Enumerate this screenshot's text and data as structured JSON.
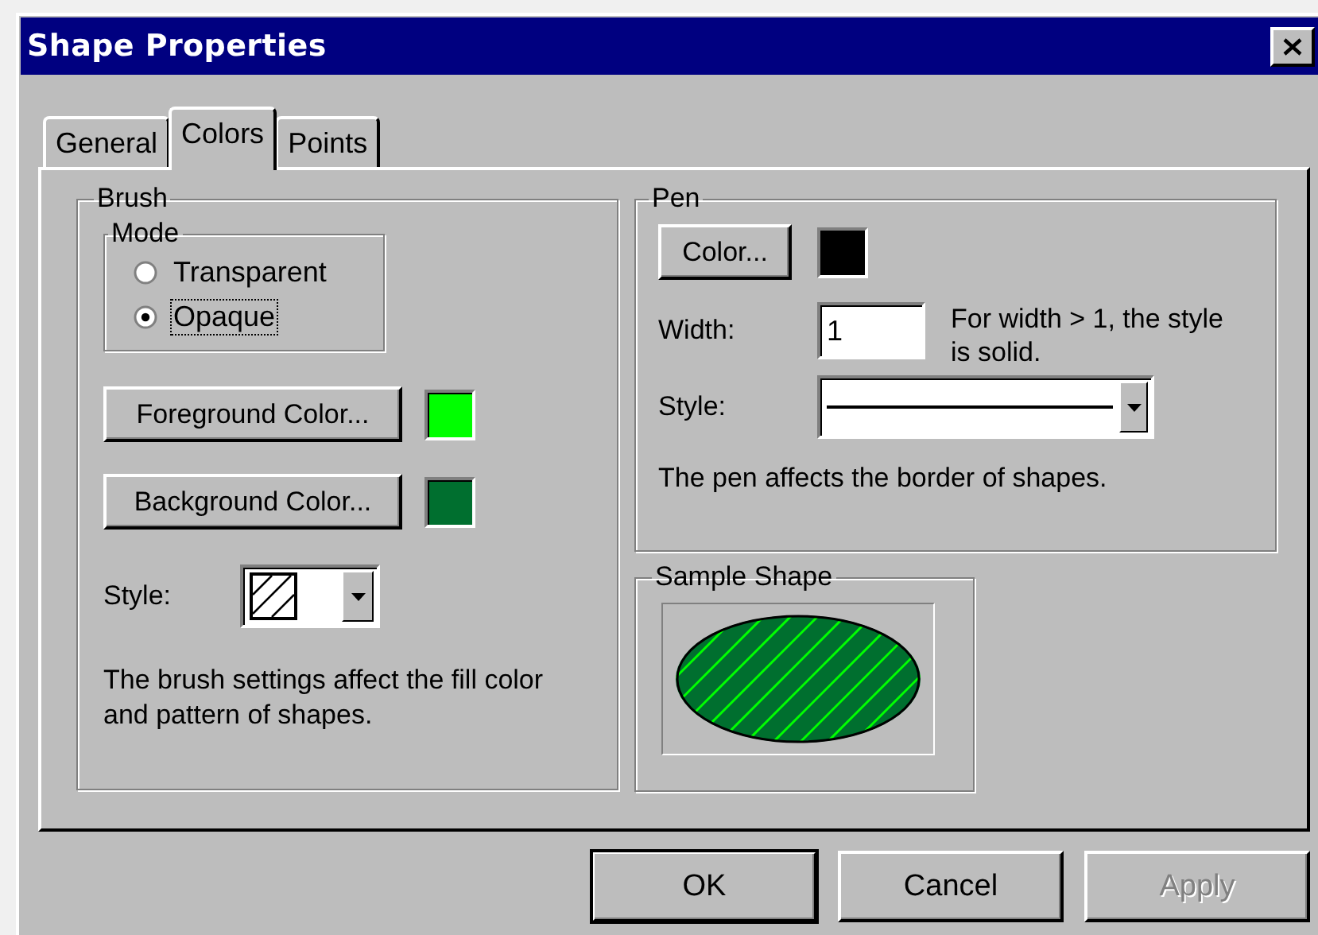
{
  "window": {
    "title": "Shape Properties"
  },
  "tabs": [
    {
      "label": "General",
      "selected": false
    },
    {
      "label": "Colors",
      "selected": true
    },
    {
      "label": "Points",
      "selected": false
    }
  ],
  "brush": {
    "title": "Brush",
    "mode": {
      "title": "Mode",
      "options": [
        {
          "label": "Transparent",
          "selected": false,
          "focused": false
        },
        {
          "label": "Opaque",
          "selected": true,
          "focused": true
        }
      ]
    },
    "color_buttons": [
      {
        "label": "Foreground Color...",
        "color": "#00ff00"
      },
      {
        "label": "Background Color...",
        "color": "#006f2f"
      }
    ],
    "style": {
      "label": "Style:"
    },
    "note": "The brush settings affect the fill color and pattern of shapes."
  },
  "pen": {
    "title": "Pen",
    "color_button": {
      "label": "Color...",
      "color": "#000000"
    },
    "width": {
      "label": "Width:",
      "value": "1"
    },
    "width_hint": "For width > 1, the style is solid.",
    "style": {
      "label": "Style:"
    },
    "note": "The pen affects the border of shapes."
  },
  "sample": {
    "title": "Sample Shape"
  },
  "buttons": [
    {
      "label": "OK",
      "default": true,
      "disabled": false
    },
    {
      "label": "Cancel",
      "default": false,
      "disabled": false
    },
    {
      "label": "Apply",
      "default": false,
      "disabled": true
    }
  ]
}
